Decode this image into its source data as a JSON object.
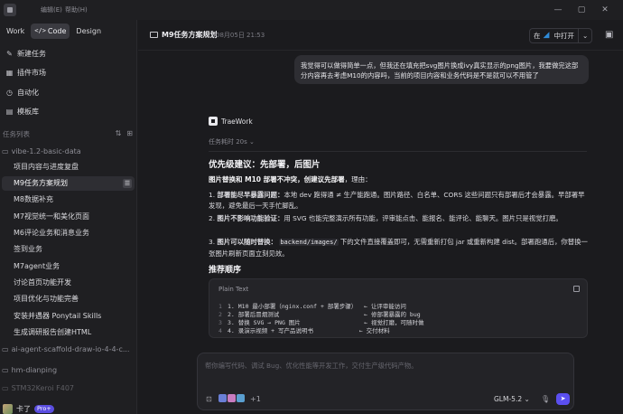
{
  "menu": {
    "edit": "编辑(E)",
    "help": "帮助(H)"
  },
  "sidebar": {
    "modes": [
      "Work",
      "Code",
      "Design"
    ],
    "nav": [
      "新建任务",
      "插件市场",
      "自动化",
      "模板库"
    ],
    "section_title": "任务列表",
    "groups": [
      {
        "name": "vibe-1.2-basic-data",
        "tasks": [
          "项目内容与进度复盘",
          "M9任务方案规划",
          "M8数据补充",
          "M7视觉统一和美化页面",
          "M6评论业务和消息业务",
          "签到业务",
          "M7agent业务",
          "讨论首页功能开发",
          "项目优化与功能完善",
          "安装并遇器 Ponytail Skills",
          "生成调研报告创建HTML"
        ]
      },
      {
        "name": "ai-agent-scaffold-draw-io-4-4-c...",
        "tasks": []
      },
      {
        "name": "hm-dianping",
        "tasks": []
      },
      {
        "name": "STM32Keroi F407",
        "tasks": []
      }
    ],
    "user": {
      "name": "卡了",
      "badge": "Pro+"
    }
  },
  "header": {
    "title": "M9任务方案规划",
    "date": "08月05日 21:53",
    "open_in_prefix": "在",
    "open_in_target": "中打开"
  },
  "chat": {
    "user_message": "我觉得可以做得简单一点，但我还在填充把svg图片换成ivy真实显示的png图片，我要做完这部分内容再去考虑M10的内容吗，当前的项目内容和业务代码是不是就可以不用管了",
    "assistant_name": "TraeWork",
    "elapsed": "任务耗时 20s",
    "heading": "优先级建议：先部署，后图片",
    "intro_bold": "图片替换和 M10 部署不冲突，创建议先部署",
    "intro_rest": "，理由：",
    "bullets": [
      {
        "num": "1.",
        "bold": "部署能尽早暴露问题：",
        "text": "本地 dev 跑得通 ≠ 生产能跑通。图片路径、白名单、CORS 这些问题只有部署后才会暴露。早部署早发现，避免最后一天手忙脚乱。"
      },
      {
        "num": "2.",
        "bold": "图片不影响功能验证：",
        "text": "用 SVG 也能完整演示所有功能，评审能点击、能报名、能评论、能聊天。图片只是视觉打磨。"
      },
      {
        "num": "3.",
        "bold": "图片可以随时替换：",
        "text_before": "",
        "code": "backend/images/",
        "text_after": "下的文件直接覆盖即可，无需重新打包 jar 或重新构建 dist。部署跑通后，你替换一张图片刷新页面立刻见效。"
      }
    ],
    "subheading": "推荐顺序",
    "code_block": {
      "lang": "Plain Text",
      "lines": [
        "1. M10 最小部署（nginx.conf + 部署步骤）  ← 让评审能访问",
        "2. 部署后冒烟测试                        ← 修部署暴露的 bug",
        "3. 替换 SVG → PNG 图片                  ← 视觉打磨，可随时做",
        "4. 录演示视频 + 写产品说明书             ← 交付材料"
      ]
    }
  },
  "composer": {
    "placeholder": "帮你编写代码、调试 Bug、优化性能等开发工作，交付生产级代码产物。",
    "attachment_count": "+1",
    "model": "GLM-5.2"
  },
  "colors": {
    "accent": "#5b4ff0",
    "background": "#1b1b1e",
    "sidebar": "#1f1f22",
    "vscode": "#2f8bd8"
  }
}
